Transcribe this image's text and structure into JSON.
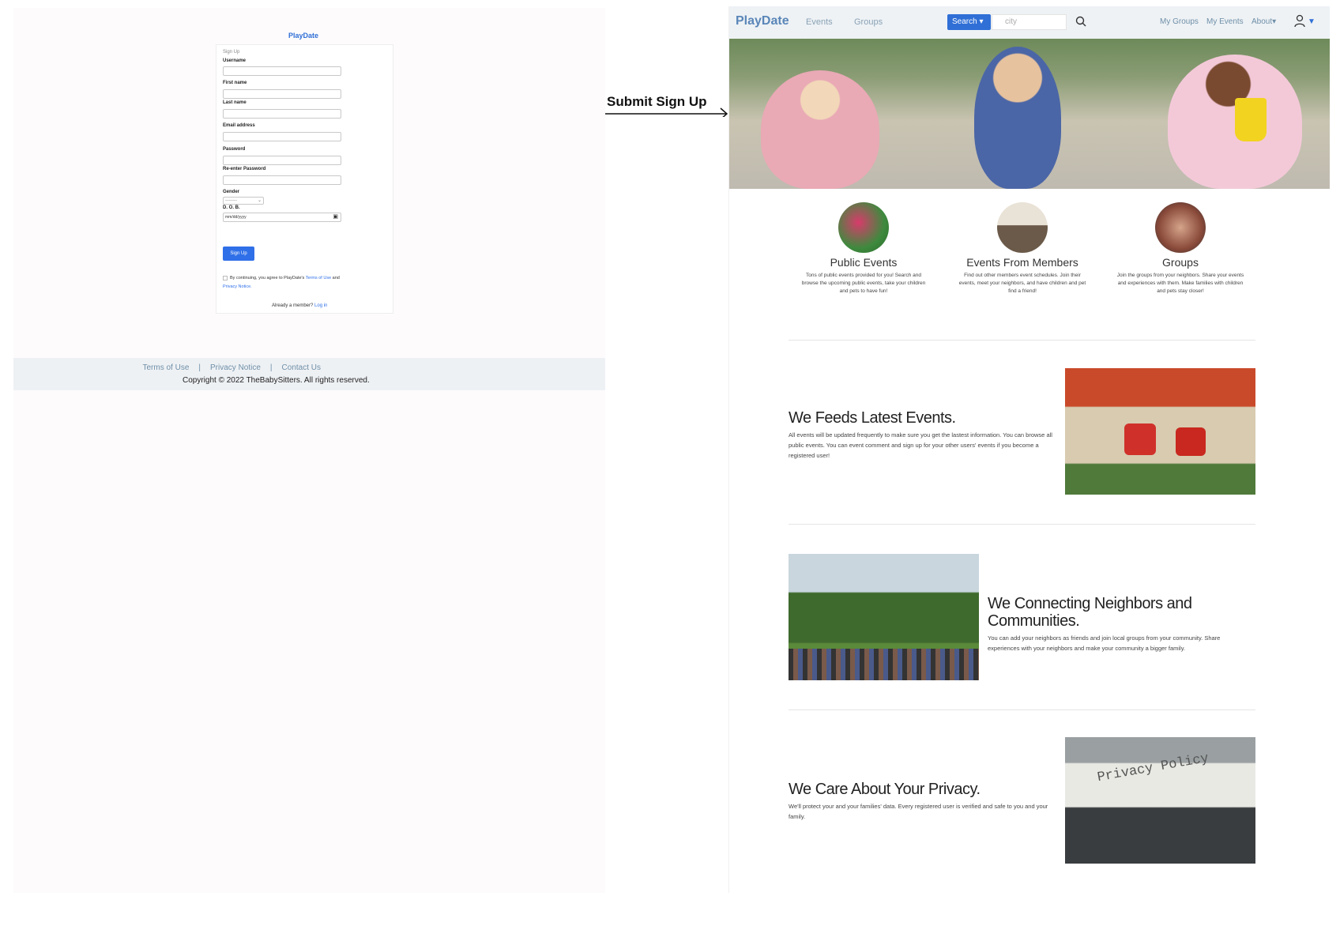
{
  "signup": {
    "brand": "PlayDate",
    "form_title": "Sign Up",
    "fields": {
      "username": "Username",
      "first_name": "First name",
      "last_name": "Last name",
      "email": "Email address",
      "password": "Password",
      "reenter": "Re-enter Password",
      "gender": "Gender",
      "dob": "D. O. B."
    },
    "gender_value": "---------",
    "dob_placeholder": "mm/dd/yyyy",
    "submit_label": "Sign Up",
    "agree_prefix": "By continuing, you agree to PlayDate's ",
    "agree_terms": "Terms of Use",
    "agree_and": " and ",
    "agree_privacy": "Privacy Notice.",
    "already_text": "Already a member? ",
    "login_link": "Log in",
    "footer": {
      "terms": "Terms of Use",
      "privacy": "Privacy Notice",
      "contact": "Contact Us",
      "separator": "|",
      "copyright": "Copyright © 2022 TheBabySitters. All rights reserved."
    }
  },
  "annotation": {
    "label": "Submit Sign Up"
  },
  "home": {
    "nav": {
      "brand": "PlayDate",
      "events": "Events",
      "groups": "Groups",
      "search_label": "Search ▾",
      "city_placeholder": "city",
      "my_groups": "My Groups",
      "my_events": "My Events",
      "about": "About▾"
    },
    "features": [
      {
        "title": "Public Events",
        "desc": "Tons of public events provided for you! Search and browse the upcoming public events, take your children and pets to have fun!"
      },
      {
        "title": "Events From Members",
        "desc": "Find out other members event schedules. Join their events, meet your neighbors, and have children and pet find a friend!"
      },
      {
        "title": "Groups",
        "desc": "Join the groups from your neighbors. Share your events and experiences with them. Make families with children and pets stay closer!"
      }
    ],
    "sections": [
      {
        "title": "We Feeds Latest Events.",
        "desc": "All events will be updated frequently to make sure you get the lastest information. You can browse all public events. You can event comment and sign up for your other users' events if you become a registered user!"
      },
      {
        "title": "We Connecting Neighbors and Communities.",
        "desc": "You can add your neighbors as friends and join local groups from your community. Share experiences with your neighbors and make your community a bigger family."
      },
      {
        "title": "We Care About Your Privacy.",
        "desc": "We'll protect your and your families' data. Every registered user is verified and safe to you and your family."
      }
    ],
    "privacy_photo_text": "Privacy Policy"
  },
  "colors": {
    "brand_blue": "#2f6fd6",
    "nav_bg": "#eef2f5",
    "footer_bg": "#eef1f4"
  }
}
